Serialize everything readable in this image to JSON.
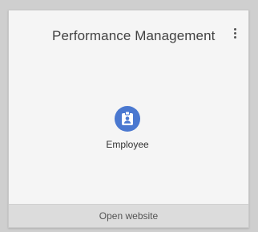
{
  "card": {
    "title": "Performance Management",
    "menu_icon": "more-vert-icon"
  },
  "app": {
    "label": "Employee",
    "icon": "id-badge-icon",
    "icon_color": "#4a78d0"
  },
  "footer": {
    "label": "Open website"
  }
}
